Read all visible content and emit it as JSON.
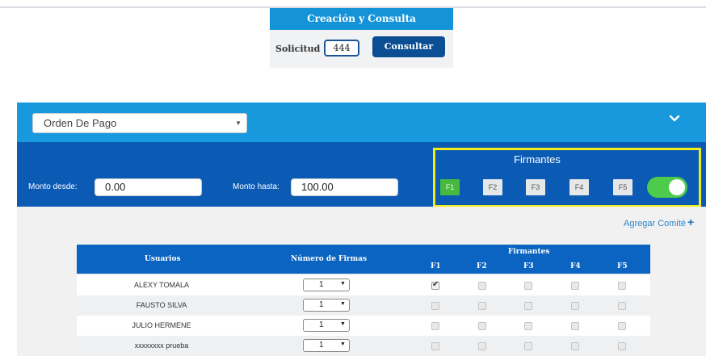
{
  "consulta": {
    "title": "Creación y Consulta",
    "solicitud_label": "Solicitud :",
    "solicitud_value": "444",
    "consultar_label": "Consultar"
  },
  "panel": {
    "type_select": "Orden De Pago",
    "monto_desde_label": "Monto desde:",
    "monto_desde_value": "0.00",
    "monto_hasta_label": "Monto hasta:",
    "monto_hasta_value": "100.00",
    "firmantes_title": "Firmantes",
    "firmantes_buttons": [
      "F1",
      "F2",
      "F3",
      "F4",
      "F5"
    ],
    "firmantes_active": "F1",
    "toggle_on": true,
    "agregar_label": "Agregar Comité"
  },
  "table": {
    "col_usuarios": "Usuarios",
    "col_numero": "Número de Firmas",
    "col_firmantes": "Firmantes",
    "firm_cols": [
      "F1",
      "F2",
      "F3",
      "F4",
      "F5"
    ],
    "rows": [
      {
        "name": "ALEXY TOMALA",
        "firmas": "1",
        "checks": [
          true,
          false,
          false,
          false,
          false
        ]
      },
      {
        "name": "FAUSTO SILVA",
        "firmas": "1",
        "checks": [
          false,
          false,
          false,
          false,
          false
        ]
      },
      {
        "name": "JULIO HERMENE",
        "firmas": "1",
        "checks": [
          false,
          false,
          false,
          false,
          false
        ]
      },
      {
        "name": "xxxxxxxx prueba",
        "firmas": "1",
        "checks": [
          false,
          false,
          false,
          false,
          false
        ]
      }
    ]
  },
  "colors": {
    "light_blue": "#1898dd",
    "dark_blue": "#0b5bb5",
    "highlight": "#f2ec1b",
    "active_green": "#47b93f"
  }
}
